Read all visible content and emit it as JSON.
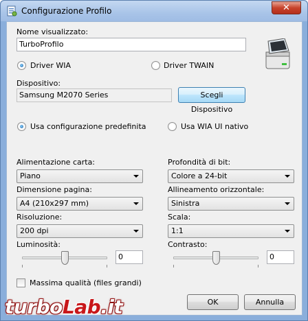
{
  "window": {
    "title": "Configurazione Profilo",
    "close_label": "✕"
  },
  "profile": {
    "name_label": "Nome visualizzato:",
    "name_value": "TurboProfilo"
  },
  "driver": {
    "wia_label": "Driver WIA",
    "twain_label": "Driver TWAIN",
    "selected": "wia"
  },
  "device": {
    "label": "Dispositivo:",
    "value": "Samsung M2070 Series",
    "choose_button": "Scegli Dispositivo"
  },
  "mode": {
    "default_label": "Usa configurazione predefinita",
    "native_label": "Usa WIA UI nativo",
    "selected": "default"
  },
  "settings": {
    "paper_feed": {
      "label": "Alimentazione carta:",
      "value": "Piano"
    },
    "bit_depth": {
      "label": "Profondità di bit:",
      "value": "Colore a 24-bit"
    },
    "page_size": {
      "label": "Dimensione pagina:",
      "value": "A4 (210x297 mm)"
    },
    "h_align": {
      "label": "Allineamento orizzontale:",
      "value": "Sinistra"
    },
    "resolution": {
      "label": "Risoluzione:",
      "value": "200 dpi"
    },
    "scale": {
      "label": "Scala:",
      "value": "1:1"
    }
  },
  "brightness": {
    "label": "Luminosità:",
    "value": "0",
    "level": 0.5
  },
  "contrast": {
    "label": "Contrasto:",
    "value": "0",
    "level": 0.5
  },
  "max_quality": {
    "label": "Massima qualità (files grandi)",
    "checked": false
  },
  "buttons": {
    "ok": "OK",
    "cancel": "Annulla"
  },
  "watermark": {
    "part1": "turbo",
    "part2": "Lab",
    "part3": ".it"
  },
  "icons": {
    "title": "profile-config-icon",
    "scanner": "scanner-icon"
  }
}
